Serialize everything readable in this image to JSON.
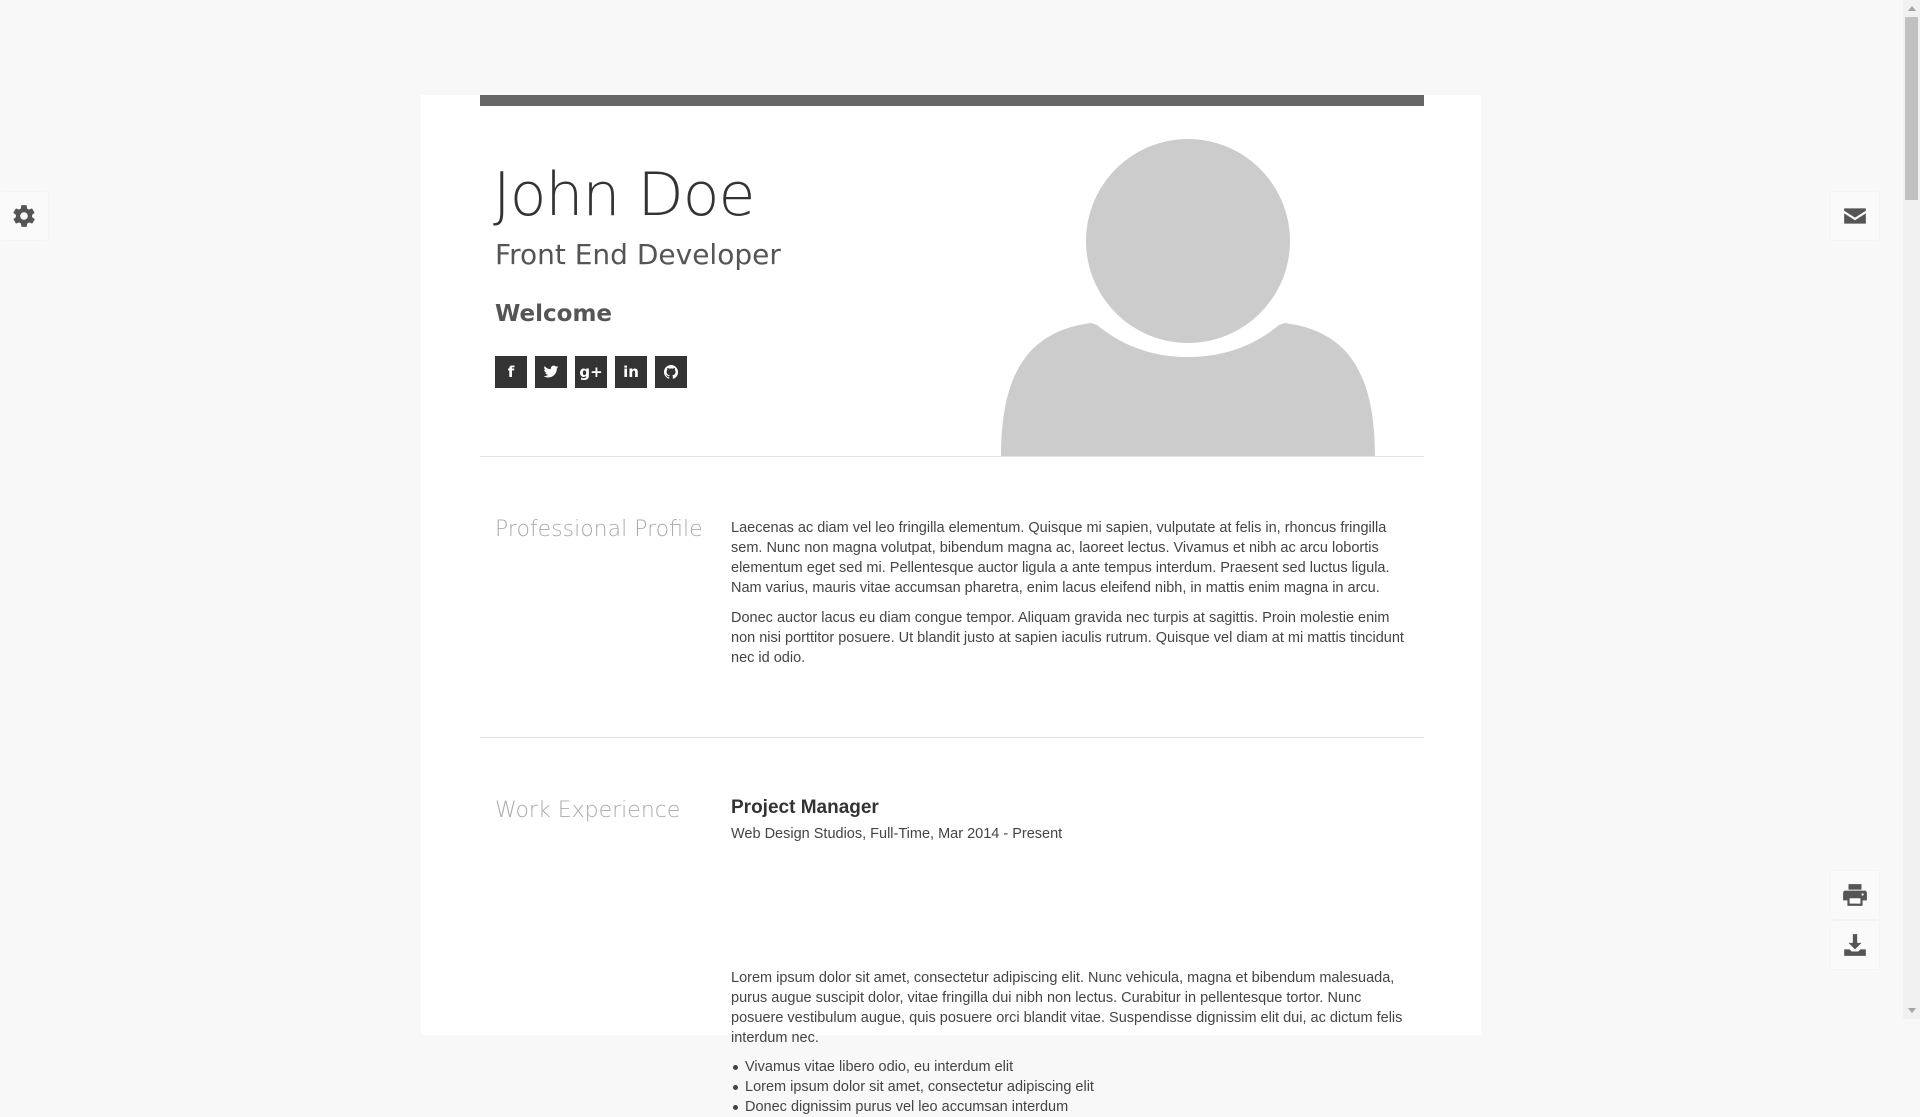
{
  "header": {
    "name": "John Doe",
    "title": "Front End Developer",
    "welcome": "Welcome"
  },
  "social": [
    {
      "icon": "facebook-icon",
      "glyph": "f"
    },
    {
      "icon": "twitter-icon",
      "glyph": ""
    },
    {
      "icon": "google-plus-icon",
      "glyph": "g+"
    },
    {
      "icon": "linkedin-icon",
      "glyph": "in"
    },
    {
      "icon": "github-icon",
      "glyph": ""
    }
  ],
  "profile": {
    "heading": "Professional Profile",
    "paragraphs": [
      "Laecenas ac diam vel leo fringilla elementum. Quisque mi sapien, vulputate at felis in, rhoncus fringilla sem. Nunc non magna volutpat, bibendum magna ac, laoreet lectus. Vivamus et nibh ac arcu lobortis elementum eget sed mi. Pellentesque auctor ligula a ante tempus interdum. Praesent sed luctus ligula. Nam varius, mauris vitae accumsan pharetra, enim lacus eleifend nibh, in mattis enim magna in arcu.",
      "Donec auctor lacus eu diam congue tempor. Aliquam gravida nec turpis at sagittis. Proin molestie enim non nisi porttitor posuere. Ut blandit justo at sapien iaculis rutrum. Quisque vel diam at mi mattis tincidunt nec id odio."
    ]
  },
  "experience": {
    "heading": "Work Experience",
    "job": {
      "title": "Project Manager",
      "meta": "Web Design Studios, Full-Time, Mar 2014 - Present",
      "description": "Lorem ipsum dolor sit amet, consectetur adipiscing elit. Nunc vehicula, magna et bibendum malesuada, purus augue suscipit dolor, vitae fringilla dui nibh non lectus. Curabitur in pellentesque tortor. Nunc posuere vestibulum augue, quis posuere orci blandit vitae. Suspendisse dignissim elit dui, ac dictum felis interdum nec.",
      "bullets": [
        "Vivamus vitae libero odio, eu interdum elit",
        "Lorem ipsum dolor sit amet, consectetur adipiscing elit",
        "Donec dignissim purus vel leo accumsan interdum"
      ]
    }
  },
  "colors": {
    "page_bg": "#f8f8f8",
    "card_bg": "#ffffff",
    "accent_bar": "#666666",
    "social_bg": "#333333",
    "avatar": "#cccccc",
    "section_title": "#aaaaaa"
  }
}
